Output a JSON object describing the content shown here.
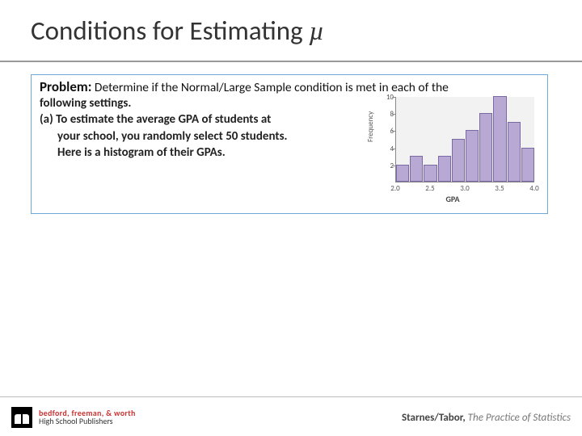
{
  "title_prefix": "Conditions for Estimating ",
  "title_symbol": "µ",
  "problem": {
    "label": "Problem:",
    "line1_rest": " Determine if the Normal/Large Sample condition is met in each of the",
    "line2": "following settings.",
    "part_a_lead": "(a)  To estimate the average GPA of students at",
    "part_a_l2": "your school, you randomly select 50 students.",
    "part_a_l3": "Here is a histogram of their GPAs."
  },
  "footer": {
    "logo_line1": "bedford, freeman, & worth",
    "logo_line2": "High School Publishers",
    "credit_auth": "Starnes/Tabor, ",
    "credit_book": "The Practice of Statistics"
  },
  "chart_data": {
    "type": "bar",
    "title": "",
    "xlabel": "GPA",
    "ylabel": "Frequency",
    "categories": [
      "2.0-2.2",
      "2.2-2.4",
      "2.4-2.6",
      "2.6-2.8",
      "2.8-3.0",
      "3.0-3.2",
      "3.2-3.4",
      "3.4-3.6",
      "3.6-3.8",
      "3.8-4.0"
    ],
    "values": [
      2,
      3,
      2,
      3,
      5,
      6,
      8,
      10,
      7,
      4
    ],
    "x_ticks": [
      "2.0",
      "2.5",
      "3.0",
      "3.5",
      "4.0"
    ],
    "y_ticks": [
      "2",
      "4",
      "6",
      "8",
      "10"
    ],
    "ylim": [
      0,
      10
    ]
  }
}
